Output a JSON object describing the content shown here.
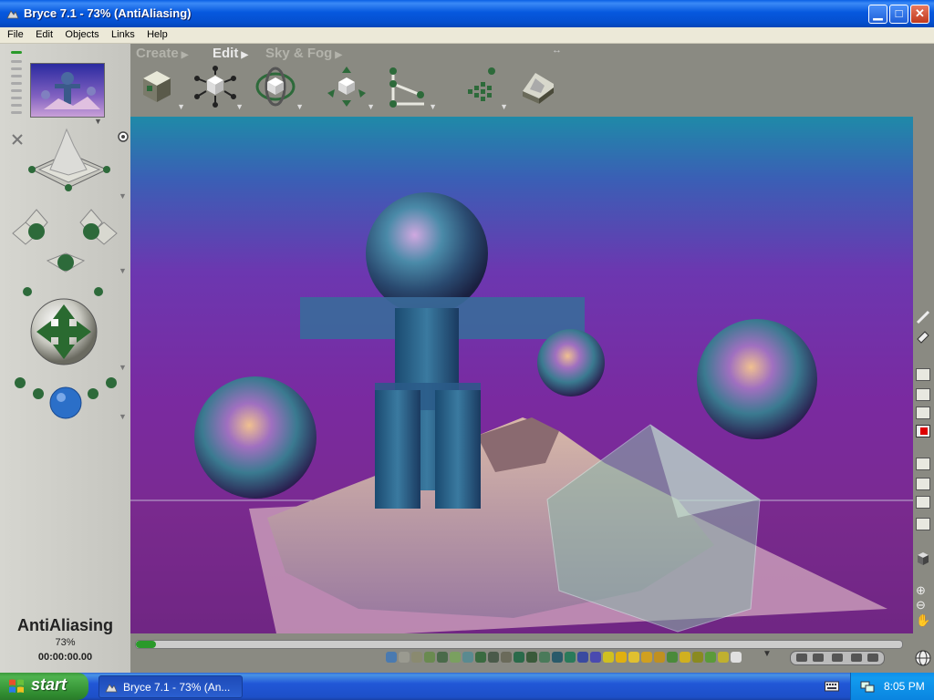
{
  "window": {
    "title": "Bryce 7.1  - 73% (AntiAliasing)",
    "controls": [
      "minimize",
      "maximize",
      "close"
    ]
  },
  "menu": {
    "items": [
      "File",
      "Edit",
      "Objects",
      "Links",
      "Help"
    ]
  },
  "toolbar": {
    "tabs": [
      {
        "label": "Create",
        "active": false
      },
      {
        "label": "Edit",
        "active": true
      },
      {
        "label": "Sky & Fog",
        "active": false
      }
    ],
    "tools": [
      "resize-tool-icon",
      "rotate-tool-icon",
      "reposition-tool-icon",
      "align-tool-icon",
      "randomize-tool-icon",
      "edit-material-icon",
      "edit-terrain-icon"
    ]
  },
  "status": {
    "title": "AntiAliasing",
    "percent": "73%",
    "time": "00:00:00.00"
  },
  "taskbar": {
    "start_label": "start",
    "task_label": "Bryce 7.1 - 73% (An...",
    "clock": "8:05 PM"
  },
  "colors": {
    "titlebar": "#0658de",
    "taskbar": "#2157d7",
    "start": "#3c9a3c",
    "tray": "#129bef",
    "sky_top": "#1f8aa8",
    "sky_mid": "#7a2aa0"
  }
}
